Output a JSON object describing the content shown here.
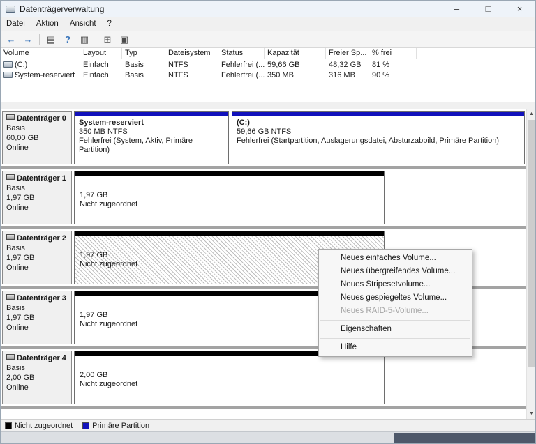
{
  "window": {
    "title": "Datenträgerverwaltung",
    "controls": {
      "minimize": "–",
      "maximize": "□",
      "close": "×"
    }
  },
  "menu_bar": {
    "items": [
      "Datei",
      "Aktion",
      "Ansicht",
      "?"
    ]
  },
  "toolbar": {
    "icons": [
      {
        "name": "back",
        "glyph": "←"
      },
      {
        "name": "forward",
        "glyph": "→"
      },
      {
        "name": "console-tree",
        "glyph": "▤"
      },
      {
        "name": "help",
        "glyph": "?"
      },
      {
        "name": "action-pane",
        "glyph": "▥"
      },
      {
        "name": "new-window",
        "glyph": "⊞"
      },
      {
        "name": "properties",
        "glyph": "▣"
      }
    ]
  },
  "volume_table": {
    "columns": [
      "Volume",
      "Layout",
      "Typ",
      "Dateisystem",
      "Status",
      "Kapazität",
      "Freier Sp...",
      "% frei"
    ],
    "rows": [
      [
        "(C:)",
        "Einfach",
        "Basis",
        "NTFS",
        "Fehlerfrei (...",
        "59,66 GB",
        "48,32 GB",
        "81 %"
      ],
      [
        "System-reserviert",
        "Einfach",
        "Basis",
        "NTFS",
        "Fehlerfrei (...",
        "350 MB",
        "316 MB",
        "90 %"
      ]
    ]
  },
  "disks": [
    {
      "name": "Datenträger 0",
      "type": "Basis",
      "size": "60,00 GB",
      "status": "Online",
      "partitions": [
        {
          "name": "System-reserviert",
          "details": "350 MB NTFS",
          "status": "Fehlerfrei (System, Aktiv, Primäre Partition)",
          "kind": "Primäre Partition"
        },
        {
          "name": "(C:)",
          "details": "59,66 GB NTFS",
          "status": "Fehlerfrei (Startpartition, Auslagerungsdatei, Absturzabbild, Primäre Partition)",
          "kind": "Primäre Partition"
        }
      ]
    },
    {
      "name": "Datenträger 1",
      "type": "Basis",
      "size": "1,97 GB",
      "status": "Online",
      "partitions": [
        {
          "size": "1,97 GB",
          "status": "Nicht zugeordnet",
          "kind": "Nicht zugeordnet"
        }
      ]
    },
    {
      "name": "Datenträger 2",
      "type": "Basis",
      "size": "1,97 GB",
      "status": "Online",
      "selected": true,
      "partitions": [
        {
          "size": "1,97 GB",
          "status": "Nicht zugeordnet",
          "kind": "Nicht zugeordnet"
        }
      ]
    },
    {
      "name": "Datenträger 3",
      "type": "Basis",
      "size": "1,97 GB",
      "status": "Online",
      "partitions": [
        {
          "size": "1,97 GB",
          "status": "Nicht zugeordnet",
          "kind": "Nicht zugeordnet"
        }
      ]
    },
    {
      "name": "Datenträger 4",
      "type": "Basis",
      "size": "2,00 GB",
      "status": "Online",
      "partitions": [
        {
          "size": "2,00 GB",
          "status": "Nicht zugeordnet",
          "kind": "Nicht zugeordnet"
        }
      ]
    }
  ],
  "context_menu": {
    "items": [
      {
        "label": "Neues einfaches Volume...",
        "enabled": true
      },
      {
        "label": "Neues übergreifendes Volume...",
        "enabled": true
      },
      {
        "label": "Neues Stripesetvolume...",
        "enabled": true
      },
      {
        "label": "Neues gespiegeltes Volume...",
        "enabled": true
      },
      {
        "label": "Neues RAID-5-Volume...",
        "enabled": false
      },
      {
        "label": "Eigenschaften",
        "enabled": true
      },
      {
        "label": "Hilfe",
        "enabled": true
      }
    ]
  },
  "legend": {
    "items": [
      {
        "label": "Nicht zugeordnet",
        "color": "#000000"
      },
      {
        "label": "Primäre Partition",
        "color": "#1111bb"
      }
    ]
  },
  "scrollbar": {
    "up_glyph": "▲",
    "down_glyph": "▼"
  },
  "colors": {
    "primary_partition_bar": "#1111bb",
    "unallocated_bar": "#000000",
    "titlebar_background": "#eef3f9"
  }
}
